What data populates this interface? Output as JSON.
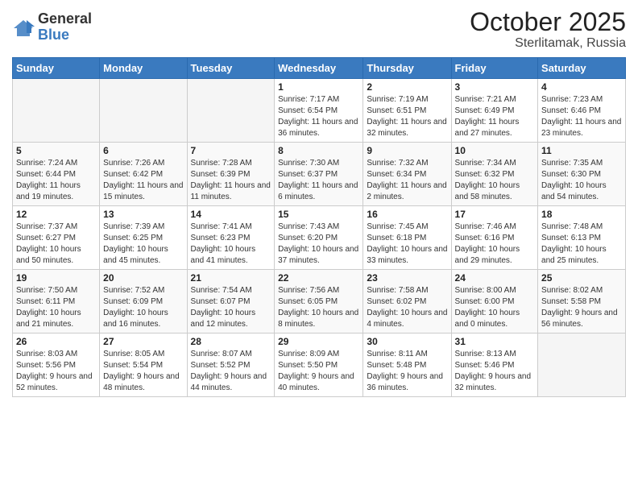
{
  "header": {
    "logo_general": "General",
    "logo_blue": "Blue",
    "month": "October 2025",
    "location": "Sterlitamak, Russia"
  },
  "columns": [
    "Sunday",
    "Monday",
    "Tuesday",
    "Wednesday",
    "Thursday",
    "Friday",
    "Saturday"
  ],
  "weeks": [
    [
      {
        "num": "",
        "info": ""
      },
      {
        "num": "",
        "info": ""
      },
      {
        "num": "",
        "info": ""
      },
      {
        "num": "1",
        "info": "Sunrise: 7:17 AM\nSunset: 6:54 PM\nDaylight: 11 hours and 36 minutes."
      },
      {
        "num": "2",
        "info": "Sunrise: 7:19 AM\nSunset: 6:51 PM\nDaylight: 11 hours and 32 minutes."
      },
      {
        "num": "3",
        "info": "Sunrise: 7:21 AM\nSunset: 6:49 PM\nDaylight: 11 hours and 27 minutes."
      },
      {
        "num": "4",
        "info": "Sunrise: 7:23 AM\nSunset: 6:46 PM\nDaylight: 11 hours and 23 minutes."
      }
    ],
    [
      {
        "num": "5",
        "info": "Sunrise: 7:24 AM\nSunset: 6:44 PM\nDaylight: 11 hours and 19 minutes."
      },
      {
        "num": "6",
        "info": "Sunrise: 7:26 AM\nSunset: 6:42 PM\nDaylight: 11 hours and 15 minutes."
      },
      {
        "num": "7",
        "info": "Sunrise: 7:28 AM\nSunset: 6:39 PM\nDaylight: 11 hours and 11 minutes."
      },
      {
        "num": "8",
        "info": "Sunrise: 7:30 AM\nSunset: 6:37 PM\nDaylight: 11 hours and 6 minutes."
      },
      {
        "num": "9",
        "info": "Sunrise: 7:32 AM\nSunset: 6:34 PM\nDaylight: 11 hours and 2 minutes."
      },
      {
        "num": "10",
        "info": "Sunrise: 7:34 AM\nSunset: 6:32 PM\nDaylight: 10 hours and 58 minutes."
      },
      {
        "num": "11",
        "info": "Sunrise: 7:35 AM\nSunset: 6:30 PM\nDaylight: 10 hours and 54 minutes."
      }
    ],
    [
      {
        "num": "12",
        "info": "Sunrise: 7:37 AM\nSunset: 6:27 PM\nDaylight: 10 hours and 50 minutes."
      },
      {
        "num": "13",
        "info": "Sunrise: 7:39 AM\nSunset: 6:25 PM\nDaylight: 10 hours and 45 minutes."
      },
      {
        "num": "14",
        "info": "Sunrise: 7:41 AM\nSunset: 6:23 PM\nDaylight: 10 hours and 41 minutes."
      },
      {
        "num": "15",
        "info": "Sunrise: 7:43 AM\nSunset: 6:20 PM\nDaylight: 10 hours and 37 minutes."
      },
      {
        "num": "16",
        "info": "Sunrise: 7:45 AM\nSunset: 6:18 PM\nDaylight: 10 hours and 33 minutes."
      },
      {
        "num": "17",
        "info": "Sunrise: 7:46 AM\nSunset: 6:16 PM\nDaylight: 10 hours and 29 minutes."
      },
      {
        "num": "18",
        "info": "Sunrise: 7:48 AM\nSunset: 6:13 PM\nDaylight: 10 hours and 25 minutes."
      }
    ],
    [
      {
        "num": "19",
        "info": "Sunrise: 7:50 AM\nSunset: 6:11 PM\nDaylight: 10 hours and 21 minutes."
      },
      {
        "num": "20",
        "info": "Sunrise: 7:52 AM\nSunset: 6:09 PM\nDaylight: 10 hours and 16 minutes."
      },
      {
        "num": "21",
        "info": "Sunrise: 7:54 AM\nSunset: 6:07 PM\nDaylight: 10 hours and 12 minutes."
      },
      {
        "num": "22",
        "info": "Sunrise: 7:56 AM\nSunset: 6:05 PM\nDaylight: 10 hours and 8 minutes."
      },
      {
        "num": "23",
        "info": "Sunrise: 7:58 AM\nSunset: 6:02 PM\nDaylight: 10 hours and 4 minutes."
      },
      {
        "num": "24",
        "info": "Sunrise: 8:00 AM\nSunset: 6:00 PM\nDaylight: 10 hours and 0 minutes."
      },
      {
        "num": "25",
        "info": "Sunrise: 8:02 AM\nSunset: 5:58 PM\nDaylight: 9 hours and 56 minutes."
      }
    ],
    [
      {
        "num": "26",
        "info": "Sunrise: 8:03 AM\nSunset: 5:56 PM\nDaylight: 9 hours and 52 minutes."
      },
      {
        "num": "27",
        "info": "Sunrise: 8:05 AM\nSunset: 5:54 PM\nDaylight: 9 hours and 48 minutes."
      },
      {
        "num": "28",
        "info": "Sunrise: 8:07 AM\nSunset: 5:52 PM\nDaylight: 9 hours and 44 minutes."
      },
      {
        "num": "29",
        "info": "Sunrise: 8:09 AM\nSunset: 5:50 PM\nDaylight: 9 hours and 40 minutes."
      },
      {
        "num": "30",
        "info": "Sunrise: 8:11 AM\nSunset: 5:48 PM\nDaylight: 9 hours and 36 minutes."
      },
      {
        "num": "31",
        "info": "Sunrise: 8:13 AM\nSunset: 5:46 PM\nDaylight: 9 hours and 32 minutes."
      },
      {
        "num": "",
        "info": ""
      }
    ]
  ]
}
